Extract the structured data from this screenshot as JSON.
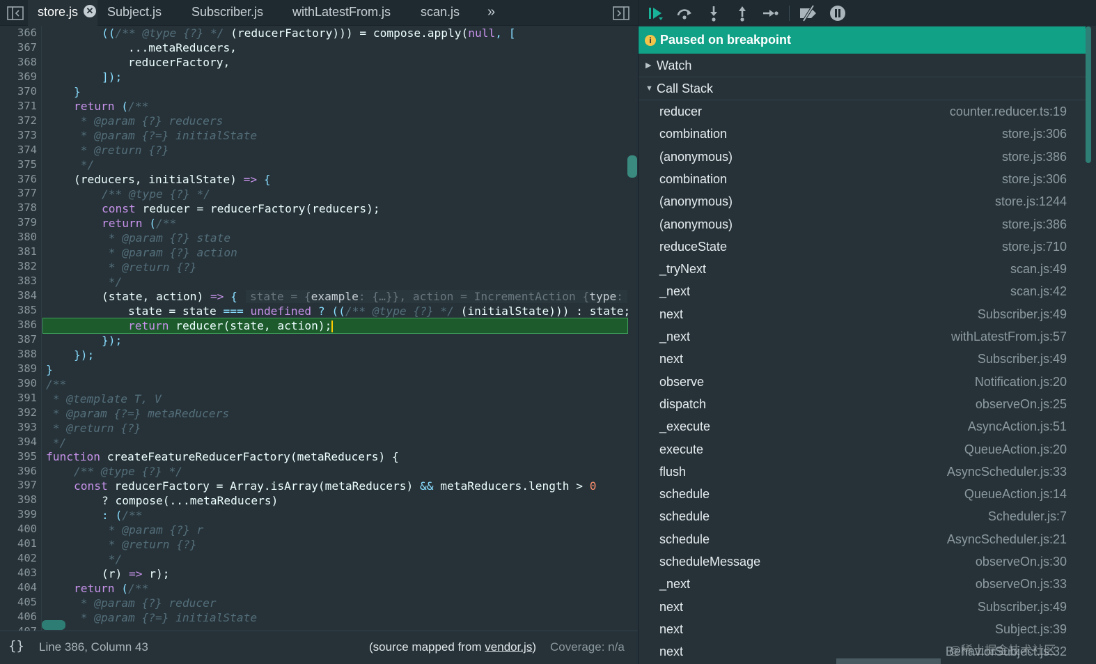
{
  "editor": {
    "tabs": [
      {
        "label": "store.js",
        "active": true
      },
      {
        "label": "Subject.js"
      },
      {
        "label": "Subscriber.js"
      },
      {
        "label": "withLatestFrom.js"
      },
      {
        "label": "scan.js"
      }
    ],
    "close_glyph": "✕",
    "more_glyph": "»",
    "line_numbers": [
      "366",
      "367",
      "368",
      "369",
      "370",
      "371",
      "372",
      "373",
      "374",
      "375",
      "376",
      "377",
      "378",
      "379",
      "380",
      "381",
      "382",
      "383",
      "384",
      "385",
      "386",
      "387",
      "388",
      "389",
      "390",
      "391",
      "392",
      "393",
      "394",
      "395",
      "396",
      "397",
      "398",
      "399",
      "400",
      "401",
      "402",
      "403",
      "404",
      "405",
      "406",
      "407"
    ],
    "code": {
      "l366_a": "((",
      "l366_b": "/** @type {?} */",
      "l366_c": " (reducerFactory))) = compose.apply(",
      "l366_d": "null",
      "l366_e": ", [",
      "l367": "...metaReducers,",
      "l368": "reducerFactory,",
      "l369": "]);",
      "l370": "}",
      "l371_kw": "return",
      "l371_rest": " (",
      "l371_cm": "/**",
      "l372": " * @param {?} reducers",
      "l373": " * @param {?=} initialState",
      "l374": " * @return {?}",
      "l375": " */",
      "l376_a": "(reducers, initialState) ",
      "l376_arrow": "=>",
      "l376_b": " {",
      "l377": "/** @type {?} */",
      "l378_kw": "const",
      "l378_rest": " reducer = reducerFactory(reducers);",
      "l379_kw": "return",
      "l379_rest": " (",
      "l379_cm": "/**",
      "l380": " * @param {?} state",
      "l381": " * @param {?} action",
      "l382": " * @return {?}",
      "l383": " */",
      "l384_a": "(state, action) ",
      "l384_arrow": "=>",
      "l384_b": " {",
      "l384_inline_a": "state = {",
      "l384_inline_b": "example",
      "l384_inline_c": ": {…}}, action = IncrementAction {",
      "l384_inline_d": "type",
      "l384_inline_e": ":",
      "l385_a": "state = state ",
      "l385_op": "===",
      "l385_undef": " undefined",
      "l385_b": " ? ((",
      "l385_cm": "/** @type {?} */",
      "l385_c": " (initialState))) : state;",
      "l386_kw": "return",
      "l386_rest": " reducer(state, action);",
      "l387": "});",
      "l388": "});",
      "l389": "}",
      "l390": "/**",
      "l391": " * @template T, V",
      "l392": " * @param {?=} metaReducers",
      "l393": " * @return {?}",
      "l394": " */",
      "l395_kw": "function",
      "l395_rest": " createFeatureReducerFactory(metaReducers) {",
      "l396": "/** @type {?} */",
      "l397_kw": "const",
      "l397_a": " reducerFactory = Array.isArray(metaReducers) ",
      "l397_op": "&&",
      "l397_b": " metaReducers.length > ",
      "l397_num": "0",
      "l398": "? compose(...metaReducers)",
      "l399_a": ": (",
      "l399_cm": "/**",
      "l400": " * @param {?} r",
      "l401": " * @return {?}",
      "l402": " */",
      "l403_a": "(r) ",
      "l403_arrow": "=>",
      "l403_b": " r);",
      "l404_kw": "return",
      "l404_rest": " (",
      "l404_cm": "/**",
      "l405": " * @param {?} reducer",
      "l406": " * @param {?=} initialState"
    },
    "status": {
      "braces": "{}",
      "position": "Line 386, Column 43",
      "source_prefix": "(source mapped from ",
      "source_link": "vendor.js",
      "source_suffix": ")",
      "coverage": "Coverage: n/a"
    }
  },
  "debugger": {
    "toolbar_icons": [
      "resume-icon",
      "step-over-icon",
      "step-into-icon",
      "step-out-icon",
      "step-icon",
      "deactivate-breakpoints-icon",
      "pause-on-exceptions-icon"
    ],
    "banner": {
      "icon": "i",
      "text": "Paused on breakpoint"
    },
    "watch_label": "Watch",
    "callstack_label": "Call Stack",
    "call_stack": [
      {
        "fn": "reducer",
        "loc": "counter.reducer.ts:19"
      },
      {
        "fn": "combination",
        "loc": "store.js:306"
      },
      {
        "fn": "(anonymous)",
        "loc": "store.js:386"
      },
      {
        "fn": "combination",
        "loc": "store.js:306"
      },
      {
        "fn": "(anonymous)",
        "loc": "store.js:1244"
      },
      {
        "fn": "(anonymous)",
        "loc": "store.js:386"
      },
      {
        "fn": "reduceState",
        "loc": "store.js:710"
      },
      {
        "fn": "_tryNext",
        "loc": "scan.js:49"
      },
      {
        "fn": "_next",
        "loc": "scan.js:42"
      },
      {
        "fn": "next",
        "loc": "Subscriber.js:49"
      },
      {
        "fn": "_next",
        "loc": "withLatestFrom.js:57"
      },
      {
        "fn": "next",
        "loc": "Subscriber.js:49"
      },
      {
        "fn": "observe",
        "loc": "Notification.js:20"
      },
      {
        "fn": "dispatch",
        "loc": "observeOn.js:25"
      },
      {
        "fn": "_execute",
        "loc": "AsyncAction.js:51"
      },
      {
        "fn": "execute",
        "loc": "QueueAction.js:20"
      },
      {
        "fn": "flush",
        "loc": "AsyncScheduler.js:33"
      },
      {
        "fn": "schedule",
        "loc": "QueueAction.js:14"
      },
      {
        "fn": "schedule",
        "loc": "Scheduler.js:7"
      },
      {
        "fn": "schedule",
        "loc": "AsyncScheduler.js:21"
      },
      {
        "fn": "scheduleMessage",
        "loc": "observeOn.js:30"
      },
      {
        "fn": "_next",
        "loc": "observeOn.js:33"
      },
      {
        "fn": "next",
        "loc": "Subscriber.js:49"
      },
      {
        "fn": "next",
        "loc": "Subject.js:39"
      },
      {
        "fn": "next",
        "loc": "BehaviorSubject.js:32"
      }
    ],
    "watermark": "@稀土掘金技术社区"
  },
  "colors": {
    "background": "#263238",
    "banner": "#10a187",
    "current_line": "#1d5a2c",
    "keyword": "#c792ea",
    "comment": "#546e7a",
    "punctuation": "#89ddff",
    "number": "#f78c6c"
  }
}
